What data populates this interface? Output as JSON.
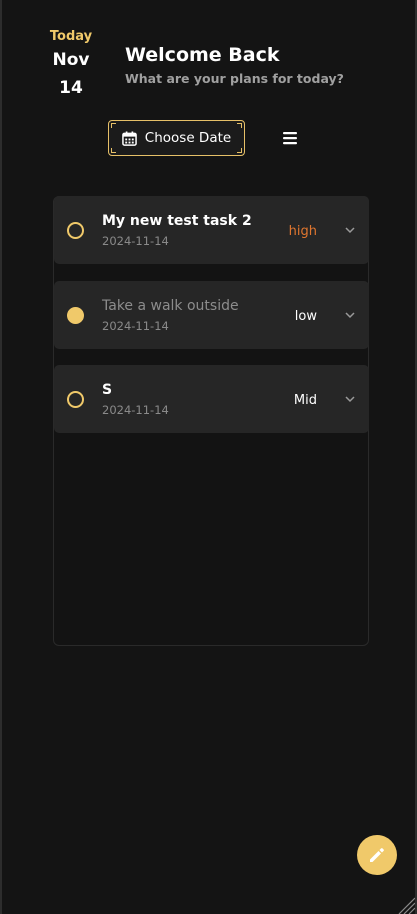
{
  "header": {
    "today_label": "Today",
    "month": "Nov",
    "day": "14",
    "title": "Welcome Back",
    "subtitle": "What are your plans for today?"
  },
  "toolbar": {
    "choose_date_label": "Choose Date",
    "calendar_icon": "calendar-icon",
    "menu_icon": "hamburger-menu-icon"
  },
  "tasks": [
    {
      "title": "My new test task 2",
      "date": "2024-11-14",
      "priority": "high",
      "priority_color": "#e0762f",
      "completed": false
    },
    {
      "title": "Take a walk outside",
      "date": "2024-11-14",
      "priority": "low",
      "priority_color": "#ffffff",
      "completed": true
    },
    {
      "title": "S",
      "date": "2024-11-14",
      "priority": "Mid",
      "priority_color": "#ffffff",
      "completed": false
    }
  ],
  "fab": {
    "icon": "pencil-icon"
  },
  "colors": {
    "accent": "#f0c96a",
    "background": "#141414",
    "card": "#262626"
  }
}
